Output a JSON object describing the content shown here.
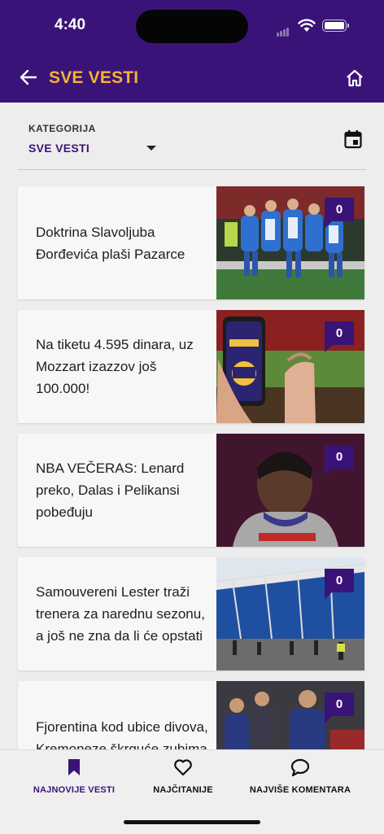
{
  "status": {
    "time": "4:40"
  },
  "header": {
    "title": "SVE VESTI",
    "back_icon": "arrow-left-icon",
    "home_icon": "home-icon"
  },
  "filter": {
    "label": "KATEGORIJA",
    "selected": "SVE VESTI",
    "calendar_icon": "calendar-icon"
  },
  "articles": [
    {
      "title": "Doktrina Slavoljuba Đorđevića plaši Pazarce",
      "comments": "0",
      "image": "football-team-celebrating"
    },
    {
      "title": "Na tiketu 4.595 dinara, uz Mozzart izazzov još 100.000!",
      "comments": "0",
      "image": "phone-with-promo-and-fist"
    },
    {
      "title": "NBA VEČERAS: Lenard preko, Dalas i Pelikansi pobeđuju",
      "comments": "0",
      "image": "basketball-player-portrait"
    },
    {
      "title": "Samouvereni Lester traži trenera za narednu sezonu, a još ne zna da li će opstati",
      "comments": "0",
      "image": "stadium-exterior"
    },
    {
      "title": "Fjorentina kod ubice divova, Kremoneze škrguće zubima",
      "comments": "0",
      "image": "football-players"
    }
  ],
  "tabs": [
    {
      "label": "NAJNOVIJE VESTI",
      "icon": "bookmark-icon",
      "active": true
    },
    {
      "label": "NAJČITANIJE",
      "icon": "heart-icon",
      "active": false
    },
    {
      "label": "NAJVIŠE KOMENTARA",
      "icon": "chat-bubble-icon",
      "active": false
    }
  ],
  "colors": {
    "primary": "#3a1378",
    "accent": "#f5b22f",
    "background": "#ededed"
  }
}
